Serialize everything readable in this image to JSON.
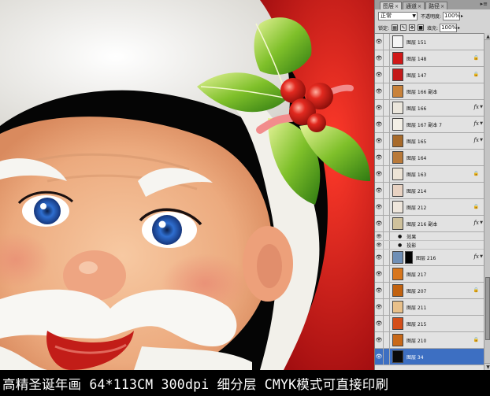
{
  "panel": {
    "tabs": [
      {
        "label": "图层",
        "active": true
      },
      {
        "label": "通道",
        "active": false
      },
      {
        "label": "路径",
        "active": false
      }
    ],
    "tab_close_glyph": "×",
    "menu_glyph": "▸≡",
    "blend_mode": "正常",
    "opacity_label": "不透明度:",
    "opacity_value": "100%",
    "lock_label": "锁定:",
    "fill_label": "填充:",
    "fill_value": "100%",
    "layers": [
      {
        "name": "图层 151",
        "thumb": "#f4f4f4",
        "kind": "layer"
      },
      {
        "name": "图层 148",
        "thumb": "#d01818",
        "kind": "layer",
        "locked": true
      },
      {
        "name": "图层 147",
        "thumb": "#c41a1a",
        "kind": "layer",
        "locked": true
      },
      {
        "name": "图层 166 副本",
        "thumb": "#c9823a",
        "kind": "layer"
      },
      {
        "name": "图层 166",
        "thumb": "#ebe6dc",
        "kind": "layer",
        "fx": true
      },
      {
        "name": "图层 167 副本 7",
        "thumb": "#f3efe6",
        "kind": "layer",
        "fx": true
      },
      {
        "name": "图层 165",
        "thumb": "#a86a2a",
        "kind": "layer",
        "fx": true
      },
      {
        "name": "图层 164",
        "thumb": "#b97a3a",
        "kind": "layer"
      },
      {
        "name": "图层 163",
        "thumb": "#ede4d6",
        "kind": "layer",
        "locked": true
      },
      {
        "name": "图层 214",
        "thumb": "#e8d2c2",
        "kind": "layer"
      },
      {
        "name": "图层 212",
        "thumb": "#eee6dc",
        "kind": "layer",
        "locked": true
      },
      {
        "name": "图层 216 副本",
        "thumb": "#cfc19c",
        "kind": "layer",
        "fx": true
      },
      {
        "name": "效果",
        "kind": "effect"
      },
      {
        "name": "投影",
        "kind": "effect"
      },
      {
        "name": "图层 216",
        "thumb": "#6f8fb6",
        "kind": "layer",
        "mask": true,
        "fx": true
      },
      {
        "name": "图层 217",
        "thumb": "#d8761c",
        "kind": "layer"
      },
      {
        "name": "图层 207",
        "thumb": "#c2620f",
        "kind": "layer",
        "locked": true
      },
      {
        "name": "图层 211",
        "thumb": "#e8c08a",
        "kind": "layer"
      },
      {
        "name": "图层 215",
        "thumb": "#d44f1a",
        "kind": "layer"
      },
      {
        "name": "图层 210",
        "thumb": "#c86818",
        "kind": "layer",
        "locked": true
      },
      {
        "name": "图层 34",
        "thumb": "#0a0a0a",
        "kind": "layer",
        "selected": true
      }
    ]
  },
  "caption": "高精圣诞年画  64*113CM 300dpi 细分层 CMYK模式可直接印刷",
  "colors": {
    "hat_red": "#d4181b",
    "fur_white": "#f7f6f2",
    "skin": "#f2b98f",
    "holly_green": "#5faa1c",
    "berry_red": "#e2291f",
    "eye_blue": "#2f6fd0",
    "selection_blue": "#3d6fc2"
  },
  "icons": {
    "eye": "eye-icon",
    "lock": "lock-icon",
    "fx": "fx-icon",
    "expand": "expand-arrow-icon"
  }
}
